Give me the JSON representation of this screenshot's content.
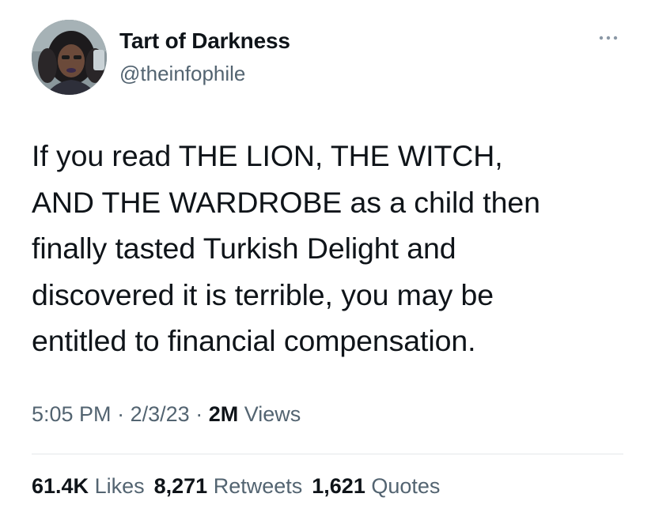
{
  "author": {
    "display_name": "Tart of Darkness",
    "handle": "@theinfophile",
    "avatar_icon": "profile-photo"
  },
  "menu": {
    "icon": "more-options-icon"
  },
  "tweet": {
    "lines": [
      "If you read THE LION, THE WITCH,",
      "AND THE WARDROBE as a child then",
      "finally tasted Turkish Delight and",
      "discovered it is terrible, you may be",
      "entitled to financial compensation."
    ]
  },
  "meta": {
    "time": "5:05 PM",
    "sep1": "·",
    "date": "2/3/23",
    "sep2": "·",
    "views_count": "2M",
    "views_label": "Views"
  },
  "stats": {
    "likes_count": "61.4K",
    "likes_label": "Likes",
    "retweets_count": "8,271",
    "retweets_label": "Retweets",
    "quotes_count": "1,621",
    "quotes_label": "Quotes"
  },
  "colors": {
    "text": "#0f1419",
    "secondary": "#536471",
    "divider": "#e4e7ea"
  }
}
